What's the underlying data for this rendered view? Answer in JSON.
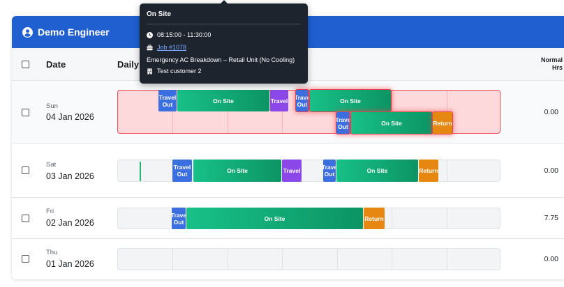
{
  "engineer": {
    "name": "Demo Engineer"
  },
  "columns": {
    "date": "Date",
    "daily": "Daily",
    "normal_hrs_line1": "Normal",
    "normal_hrs_line2": "Hrs"
  },
  "rows": [
    {
      "dow": "Sun",
      "date": "04 Jan 2026",
      "hours": "0.00"
    },
    {
      "dow": "Sat",
      "date": "03 Jan 2026",
      "hours": "0.00"
    },
    {
      "dow": "Fri",
      "date": "02 Jan 2026",
      "hours": "7.75"
    },
    {
      "dow": "Thu",
      "date": "01 Jan 2026",
      "hours": "0.00"
    }
  ],
  "labels": {
    "travel_out_1": "Travel",
    "travel_out_2": "Out",
    "travel_out_short_1": "Trave",
    "travel_out_short_2": "Out",
    "on_site": "On Site",
    "travel": "Travel",
    "return": "Return"
  },
  "tooltip": {
    "title": "On Site",
    "time": "08:15:00 - 11:30:00",
    "job": "Job #1078",
    "description": "Emergency AC Breakdown – Retail Unit (No Cooling)",
    "customer": "Test customer 2"
  },
  "colors": {
    "header": "#1f5fcf",
    "travel_out": "#3b6fe0",
    "on_site": "#10a873",
    "travel": "#8b47e8",
    "return": "#e68712",
    "alert": "#ef4d57"
  }
}
